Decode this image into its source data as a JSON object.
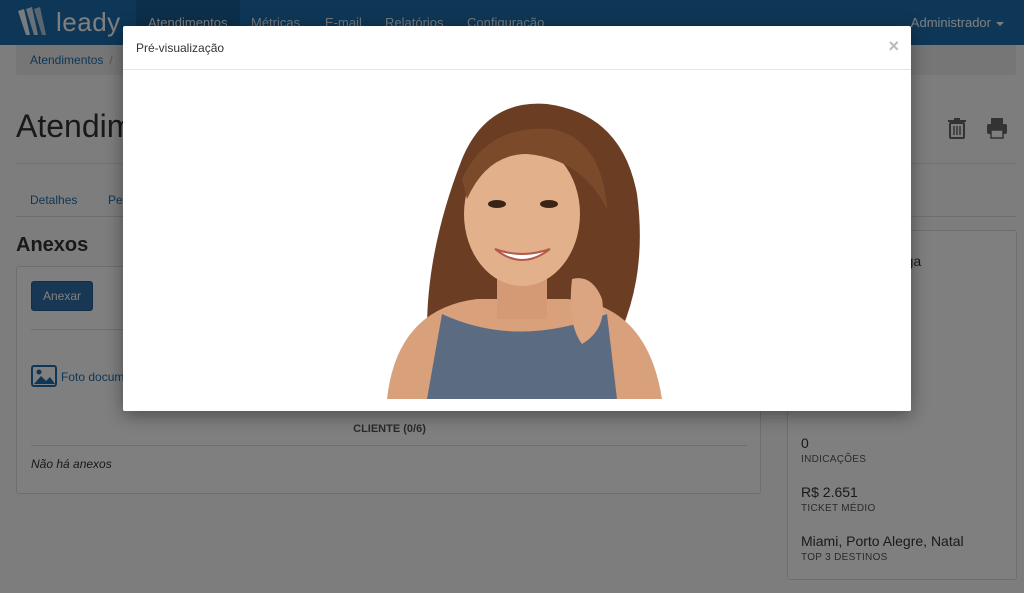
{
  "navbar": {
    "brand": "leady",
    "items": [
      "Atendimentos",
      "Métricas",
      "E-mail",
      "Relatórios",
      "Configuração"
    ],
    "user": "Administrador"
  },
  "breadcrumb": {
    "first": "Atendimentos"
  },
  "page": {
    "title": "Atendim"
  },
  "tabs": [
    "Detalhes",
    "Pe"
  ],
  "attachments": {
    "title": "Anexos",
    "add_button": "Anexar",
    "file_name": "Foto docum",
    "client_label": "CLIENTE (0/6)",
    "empty_text": "Não há anexos"
  },
  "side": {
    "name_fragment": "nzaga",
    "stats": [
      {
        "value": "0",
        "label": "INDICAÇÕES"
      },
      {
        "value": "R$ 2.651",
        "label": "TICKET MÉDIO"
      },
      {
        "value": "Miami, Porto Alegre, Natal",
        "label": "TOP 3 DESTINOS"
      }
    ]
  },
  "modal": {
    "title": "Pré-visualização",
    "close_symbol": "×"
  },
  "colors": {
    "primary": "#1d6fae",
    "button": "#2f6fa8"
  }
}
